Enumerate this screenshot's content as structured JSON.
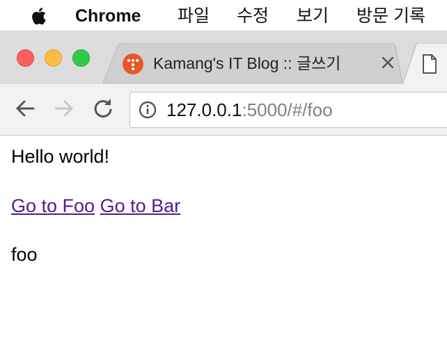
{
  "menubar": {
    "app_name": "Chrome",
    "items": [
      "파일",
      "수정",
      "보기",
      "방문 기록"
    ]
  },
  "tabs": [
    {
      "title": "Kamang's IT Blog :: 글쓰기",
      "favicon": "tistory-icon",
      "active": false
    },
    {
      "title": "",
      "favicon": "document-icon",
      "active": true
    }
  ],
  "toolbar": {
    "url_host": "127.0.0.1",
    "url_rest": ":5000/#/foo"
  },
  "content": {
    "heading": "Hello world!",
    "links": [
      "Go to Foo",
      "Go to Bar"
    ],
    "route_output": "foo"
  },
  "colors": {
    "link_visited": "#551a8b",
    "favicon": "#e8562a",
    "close": "#fc605b",
    "minimize": "#fdbc40",
    "maximize": "#34c84a"
  }
}
